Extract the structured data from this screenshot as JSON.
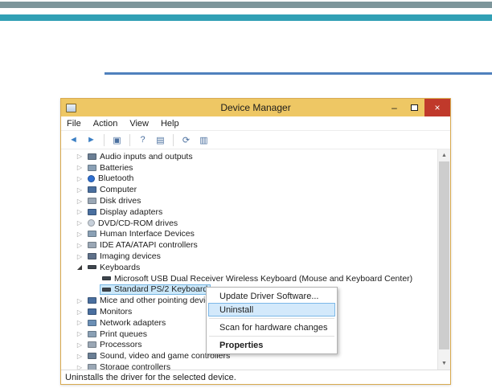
{
  "decor": {
    "top_bar_primary_color": "#7d969b",
    "top_bar_secondary_color": "#31a0b5",
    "accent_line_color": "#4f81bd"
  },
  "window": {
    "title": "Device Manager",
    "titlebar_color": "#eec764",
    "controls": {
      "minimize": "–",
      "close": "×"
    },
    "menu_items": [
      "File",
      "Action",
      "View",
      "Help"
    ],
    "status_text": "Uninstalls the driver for the selected device."
  },
  "toolbar": {
    "icons": [
      {
        "name": "back-arrow-icon",
        "glyph": "◄",
        "color": "#3b7fc4"
      },
      {
        "name": "forward-arrow-icon",
        "glyph": "►",
        "color": "#3b7fc4"
      },
      {
        "name": "separator"
      },
      {
        "name": "console-window-icon",
        "glyph": "▣"
      },
      {
        "name": "separator"
      },
      {
        "name": "help-icon",
        "glyph": "?"
      },
      {
        "name": "properties-icon",
        "glyph": "▤"
      },
      {
        "name": "separator"
      },
      {
        "name": "scan-hardware-changes-icon",
        "glyph": "⟳"
      },
      {
        "name": "uninstall-device-icon",
        "glyph": "▥"
      }
    ]
  },
  "tree": {
    "arrow_collapsed": "▷",
    "arrow_expanded": "◢",
    "items": [
      {
        "id": "audio-inputs-and-outputs",
        "label": "Audio inputs and outputs",
        "level": 1,
        "state": "collapsed",
        "icon": "speaker-icon"
      },
      {
        "id": "batteries",
        "label": "Batteries",
        "level": 1,
        "state": "collapsed",
        "icon": "battery-icon"
      },
      {
        "id": "bluetooth",
        "label": "Bluetooth",
        "level": 1,
        "state": "collapsed",
        "icon": "bluetooth-icon"
      },
      {
        "id": "computer",
        "label": "Computer",
        "level": 1,
        "state": "collapsed",
        "icon": "computer-icon"
      },
      {
        "id": "disk-drives",
        "label": "Disk drives",
        "level": 1,
        "state": "collapsed",
        "icon": "disk-drive-icon"
      },
      {
        "id": "display-adapters",
        "label": "Display adapters",
        "level": 1,
        "state": "collapsed",
        "icon": "display-adapter-icon"
      },
      {
        "id": "dvd-cd-rom-drives",
        "label": "DVD/CD-ROM drives",
        "level": 1,
        "state": "collapsed",
        "icon": "disc-icon"
      },
      {
        "id": "human-interface-devices",
        "label": "Human Interface Devices",
        "level": 1,
        "state": "collapsed",
        "icon": "hid-icon"
      },
      {
        "id": "ide-ata-atapi-controllers",
        "label": "IDE ATA/ATAPI controllers",
        "level": 1,
        "state": "collapsed",
        "icon": "controller-icon"
      },
      {
        "id": "imaging-devices",
        "label": "Imaging devices",
        "level": 1,
        "state": "collapsed",
        "icon": "camera-icon"
      },
      {
        "id": "keyboards",
        "label": "Keyboards",
        "level": 1,
        "state": "expanded",
        "icon": "keyboard-icon"
      },
      {
        "id": "microsoft-usb-dual-receiver-wireless-keyboard",
        "label": "Microsoft USB Dual Receiver Wireless Keyboard (Mouse and Keyboard Center)",
        "level": 2,
        "state": "none",
        "icon": "keyboard-icon"
      },
      {
        "id": "standard-ps2-keyboard",
        "label": "Standard PS/2 Keyboard",
        "level": 2,
        "state": "none",
        "icon": "keyboard-icon",
        "selected": true
      },
      {
        "id": "mice-and-other-pointing-devices",
        "label": "Mice and other pointing devices",
        "level": 1,
        "state": "collapsed",
        "icon": "mouse-icon"
      },
      {
        "id": "monitors",
        "label": "Monitors",
        "level": 1,
        "state": "collapsed",
        "icon": "monitor-icon"
      },
      {
        "id": "network-adapters",
        "label": "Network adapters",
        "level": 1,
        "state": "collapsed",
        "icon": "network-icon"
      },
      {
        "id": "print-queues",
        "label": "Print queues",
        "level": 1,
        "state": "collapsed",
        "icon": "printer-icon"
      },
      {
        "id": "processors",
        "label": "Processors",
        "level": 1,
        "state": "collapsed",
        "icon": "processor-icon"
      },
      {
        "id": "sound-video-and-game-controllers",
        "label": "Sound, video and game controllers",
        "level": 1,
        "state": "collapsed",
        "icon": "sound-icon"
      },
      {
        "id": "storage-controllers",
        "label": "Storage controllers",
        "level": 1,
        "state": "collapsed",
        "icon": "storage-icon"
      }
    ]
  },
  "context_menu": {
    "highlight_bg": "#d3e9fb",
    "highlight_border": "#7cb8e8",
    "items": [
      {
        "id": "update-driver-software",
        "label": "Update Driver Software...",
        "type": "item"
      },
      {
        "id": "uninstall",
        "label": "Uninstall",
        "type": "item",
        "highlighted": true
      },
      {
        "type": "separator"
      },
      {
        "id": "scan-for-hardware-changes",
        "label": "Scan for hardware changes",
        "type": "item"
      },
      {
        "type": "separator"
      },
      {
        "id": "properties",
        "label": "Properties",
        "type": "item",
        "bold": true
      }
    ]
  },
  "scrollbar": {
    "up": "▲",
    "down": "▼"
  }
}
